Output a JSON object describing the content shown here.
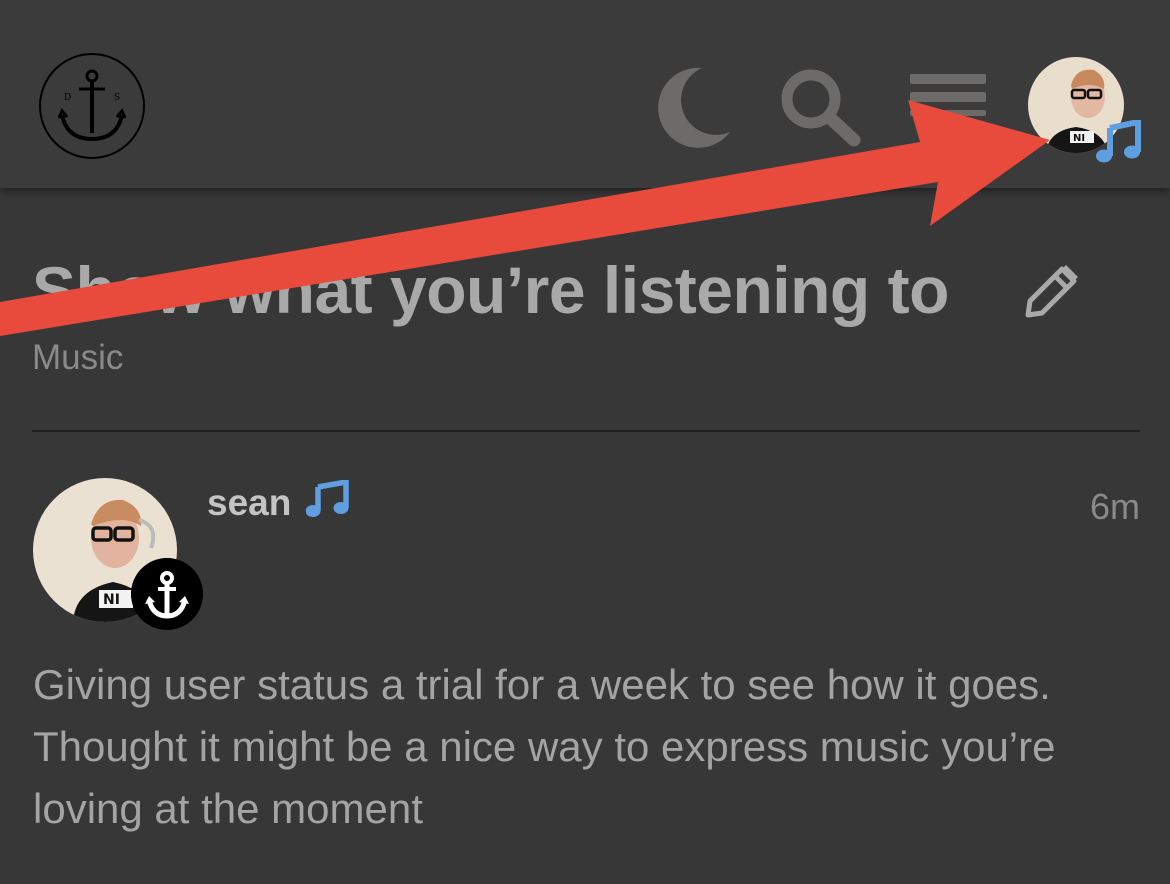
{
  "header": {
    "logo_letters": [
      "D",
      "S"
    ],
    "icons": {
      "logo": "anchor-logo-icon",
      "theme_toggle": "moon-icon",
      "search": "search-icon",
      "menu": "hamburger-menu-icon",
      "user_status": "music-note-icon"
    }
  },
  "topic": {
    "title": "Show what you’re listening to",
    "category": "Music",
    "edit_icon": "pencil-icon"
  },
  "post": {
    "username": "sean",
    "time": "6m",
    "status_icon": "music-note-icon",
    "flair_icon": "anchor-icon",
    "body_lines": [
      "Giving user status a trial for a week to see how it goes.",
      "Thought it might be a nice way to express music you’re",
      "loving at the moment"
    ]
  },
  "colors": {
    "background": "#373737",
    "header": "#3b3b3b",
    "status_accent": "#5f9ee0",
    "annotation_arrow": "#e84a3c",
    "title_text": "#a9a9a9"
  }
}
